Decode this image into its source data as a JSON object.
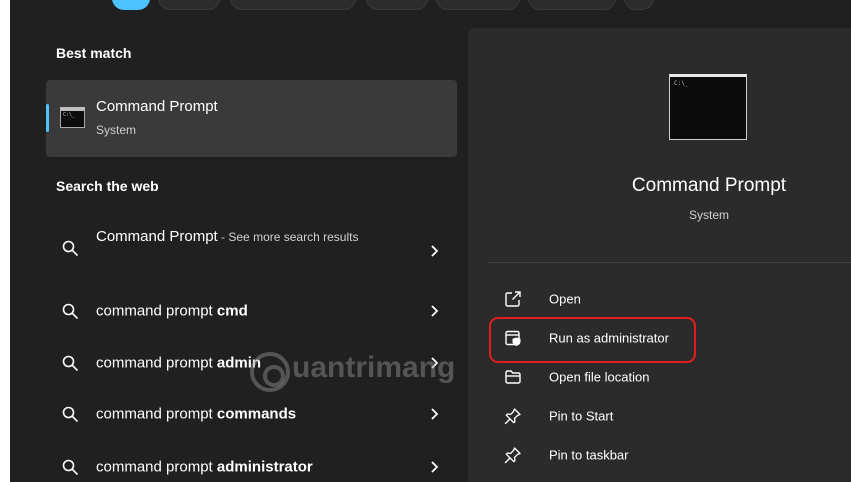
{
  "best_match": {
    "heading": "Best match",
    "item": {
      "name": "Command Prompt",
      "type": "System",
      "icon": "command-prompt-icon"
    }
  },
  "search_web": {
    "heading": "Search the web",
    "results": [
      {
        "text": "Command Prompt",
        "hint": " - See more search results"
      },
      {
        "prefix": "command prompt ",
        "bold": "cmd"
      },
      {
        "prefix": "command prompt ",
        "bold": "admin"
      },
      {
        "prefix": "command prompt ",
        "bold": "commands"
      },
      {
        "prefix": "command prompt ",
        "bold": "administrator"
      }
    ]
  },
  "details": {
    "app_name": "Command Prompt",
    "app_type": "System",
    "actions": [
      {
        "label": "Open",
        "icon": "open-icon"
      },
      {
        "label": "Run as administrator",
        "icon": "shield-icon"
      },
      {
        "label": "Open file location",
        "icon": "folder-icon"
      },
      {
        "label": "Pin to Start",
        "icon": "pin-icon"
      },
      {
        "label": "Pin to taskbar",
        "icon": "pin-icon"
      }
    ]
  },
  "watermark": "uantrimang",
  "colors": {
    "accent": "#4cc2ff",
    "highlight": "#e01d1d",
    "background": "#202020",
    "panel": "#2b2b2b"
  }
}
